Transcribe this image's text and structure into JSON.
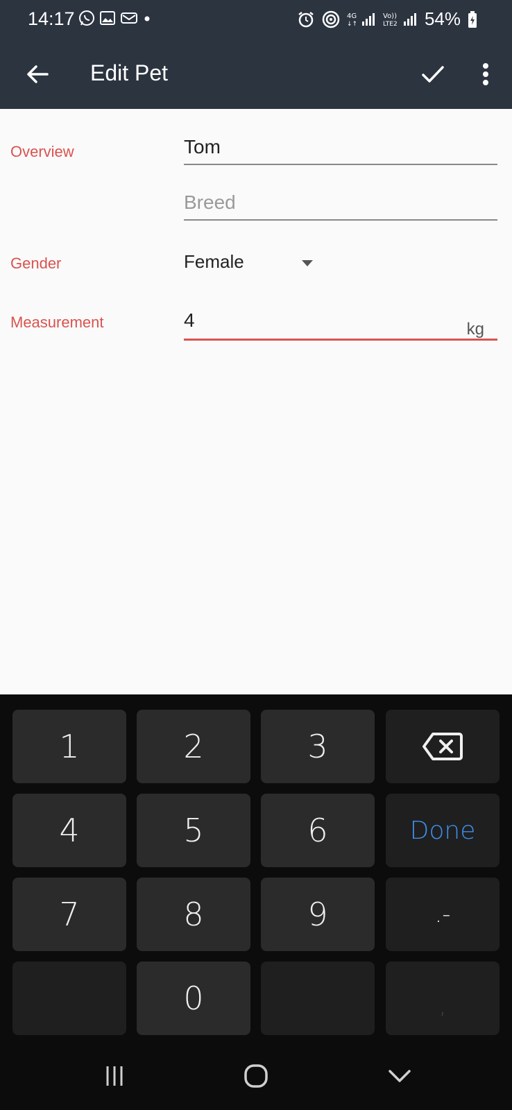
{
  "status_bar": {
    "time": "14:17",
    "battery": "54%",
    "left_icons": [
      "whatsapp-icon",
      "image-icon",
      "mail-icon",
      "dot-icon"
    ],
    "right_icons": [
      "alarm-icon",
      "hotspot-icon",
      "signal-4g-icon",
      "signal-volte-icon",
      "battery-charging-icon"
    ]
  },
  "app_bar": {
    "title": "Edit Pet",
    "back_icon": "arrow-left-icon",
    "save_icon": "check-icon",
    "menu_icon": "more-vertical-icon"
  },
  "form": {
    "overview_label": "Overview",
    "name_value": "Tom",
    "breed_placeholder": "Breed",
    "gender_label": "Gender",
    "gender_value": "Female",
    "measurement_label": "Measurement",
    "measurement_value": "4",
    "measurement_unit": "kg"
  },
  "keyboard": {
    "keys": [
      "1",
      "2",
      "3",
      "4",
      "5",
      "6",
      "7",
      "8",
      "9",
      "0"
    ],
    "done_label": "Done",
    "punct_label": ".-",
    "comma_label": ",",
    "backspace_icon": "backspace-icon"
  },
  "navbar": {
    "recents_icon": "recents-icon",
    "home_icon": "home-icon",
    "back_icon": "chevron-down-icon"
  },
  "colors": {
    "bar_bg": "#2c3440",
    "accent_red": "#d9534f",
    "done_blue": "#3d8eeb"
  }
}
